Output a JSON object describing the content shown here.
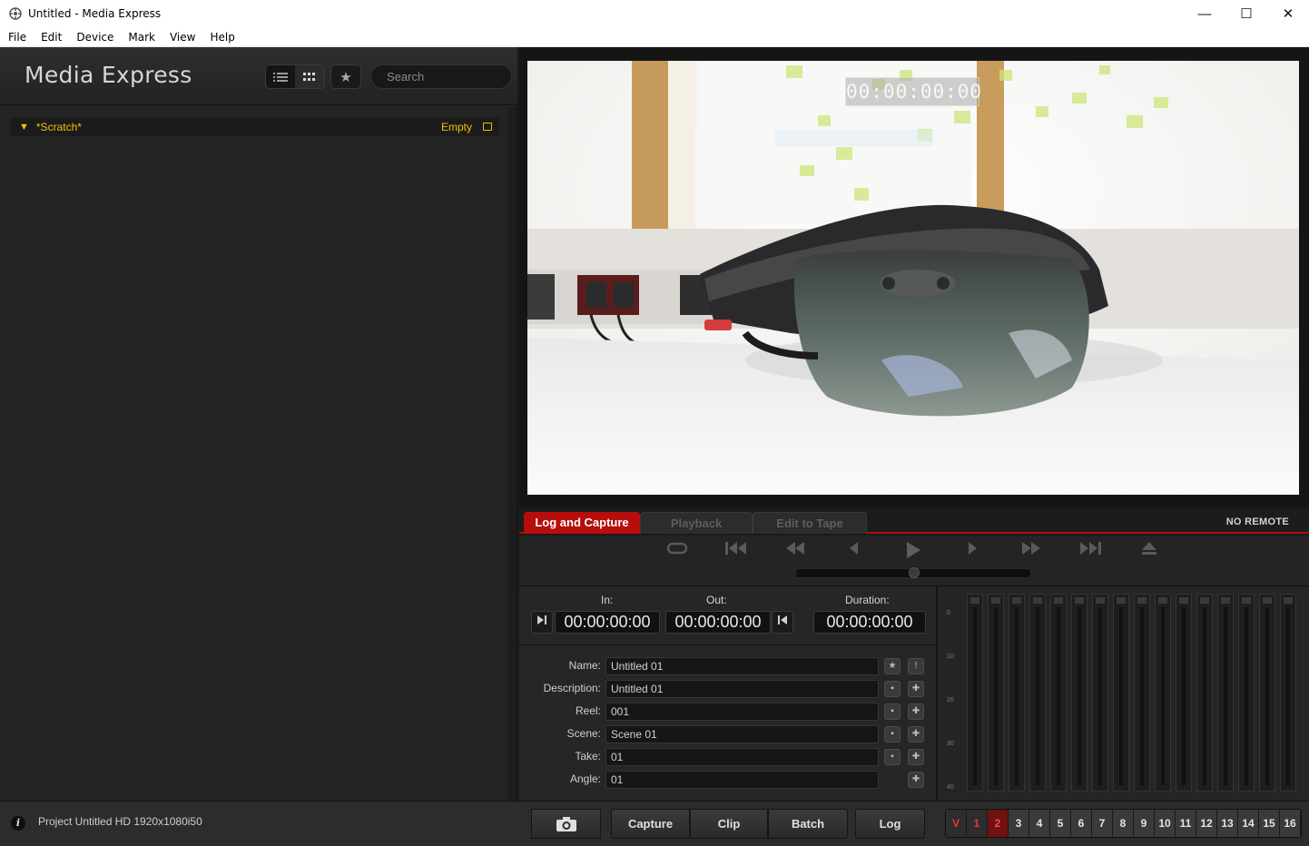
{
  "window": {
    "title": "Untitled - Media Express",
    "controls": [
      "—",
      "☐",
      "✕"
    ]
  },
  "menu": [
    "File",
    "Edit",
    "Device",
    "Mark",
    "View",
    "Help"
  ],
  "sidebar": {
    "app_name": "Media Express",
    "search_placeholder": "Search",
    "bin": {
      "name": "*Scratch*",
      "status": "Empty"
    }
  },
  "viewer": {
    "overlay_timecode": "00:00:00:00"
  },
  "tabs": {
    "items": [
      "Log and Capture",
      "Playback",
      "Edit to Tape"
    ],
    "active": "Log and Capture",
    "remote_status": "NO REMOTE"
  },
  "transport": {
    "buttons": [
      "loop-icon",
      "jump-to-start-icon",
      "rewind-icon",
      "step-back-icon",
      "play-icon",
      "step-forward-icon",
      "fast-forward-icon",
      "jump-to-end-icon",
      "eject-icon"
    ]
  },
  "log": {
    "in_label": "In:",
    "out_label": "Out:",
    "duration_label": "Duration:",
    "in_tc": "00:00:00:00",
    "out_tc": "00:00:00:00",
    "duration_tc": "00:00:00:00",
    "fields": [
      {
        "label": "Name:",
        "value": "Untitled 01"
      },
      {
        "label": "Description:",
        "value": "Untitled 01"
      },
      {
        "label": "Reel:",
        "value": "001"
      },
      {
        "label": "Scene:",
        "value": "Scene 01"
      },
      {
        "label": "Take:",
        "value": "01"
      },
      {
        "label": "Angle:",
        "value": "01"
      }
    ]
  },
  "meters": {
    "scale": [
      "0",
      "10",
      "20",
      "30",
      "40"
    ],
    "count": 16
  },
  "bottom": {
    "project_info": "Project Untitled  HD 1920x1080i50",
    "capture_label": "Capture",
    "clip_label": "Clip",
    "batch_label": "Batch",
    "log_label": "Log",
    "channels": [
      "V",
      "1",
      "2",
      "3",
      "4",
      "5",
      "6",
      "7",
      "8",
      "9",
      "10",
      "11",
      "12",
      "13",
      "14",
      "15",
      "16"
    ]
  },
  "colors": {
    "accent_red": "#b80d0d",
    "bin_yellow": "#f2c200"
  }
}
